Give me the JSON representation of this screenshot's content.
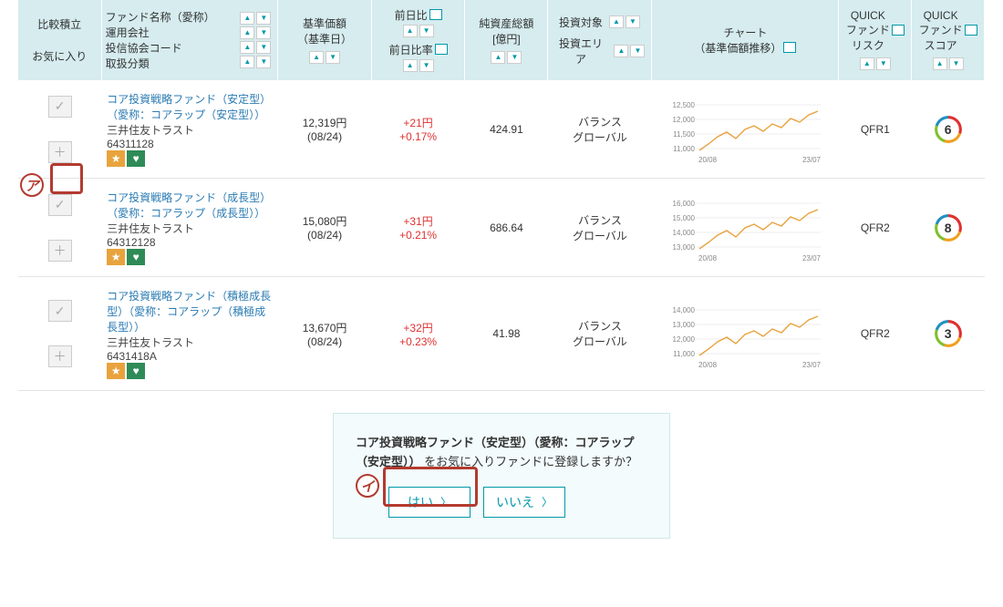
{
  "headers": {
    "compare": "比較積立",
    "favorite": "お気に入り",
    "fund_name": "ファンド名称（愛称）",
    "manager": "運用会社",
    "assoc_code": "投信協会コード",
    "category": "取扱分類",
    "price": "基準価額",
    "price_date": "（基準日）",
    "diff": "前日比",
    "diff_rate": "前日比率",
    "asset": "純資産総額",
    "asset_unit": "[億円]",
    "target": "投資対象",
    "area": "投資エリア",
    "chart": "チャート",
    "chart_sub": "（基準価額推移）",
    "risk": "QUICK\nファンド\nリスク",
    "score": "QUICK\nファンド\nスコア"
  },
  "rows": [
    {
      "name": "コア投資戦略ファンド（安定型）（愛称：コアラップ（安定型））",
      "company": "三井住友トラスト",
      "code": "64311128",
      "price": "12,319円",
      "date": "(08/24)",
      "diff": "+21円",
      "diff_rate": "+0.17%",
      "asset": "424.91",
      "target": "バランス",
      "area": "グローバル",
      "risk": "QFR1",
      "score": "6",
      "yticks": [
        "12,500",
        "12,000",
        "11,500",
        "11,000"
      ],
      "xfrom": "20/08",
      "xto": "23/07"
    },
    {
      "name": "コア投資戦略ファンド（成長型）（愛称：コアラップ（成長型））",
      "company": "三井住友トラスト",
      "code": "64312128",
      "price": "15,080円",
      "date": "(08/24)",
      "diff": "+31円",
      "diff_rate": "+0.21%",
      "asset": "686.64",
      "target": "バランス",
      "area": "グローバル",
      "risk": "QFR2",
      "score": "8",
      "yticks": [
        "16,000",
        "15,000",
        "14,000",
        "13,000"
      ],
      "xfrom": "20/08",
      "xto": "23/07"
    },
    {
      "name": "コア投資戦略ファンド（積極成長型）（愛称：コアラップ（積極成長型））",
      "company": "三井住友トラスト",
      "code": "6431418A",
      "price": "13,670円",
      "date": "(08/24)",
      "diff": "+32円",
      "diff_rate": "+0.23%",
      "asset": "41.98",
      "target": "バランス",
      "area": "グローバル",
      "risk": "QFR2",
      "score": "3",
      "yticks": [
        "14,000",
        "13,000",
        "12,000",
        "11,000"
      ],
      "xfrom": "20/08",
      "xto": "23/07"
    }
  ],
  "confirm": {
    "fund_name": "コア投資戦略ファンド（安定型）（愛称：コアラップ（安定型））",
    "message_tail": "をお気に入りファンドに登録しますか？",
    "yes": "はい",
    "no": "いいえ"
  },
  "annotations": {
    "a": "ア",
    "i": "イ"
  },
  "chart_data": [
    {
      "type": "line",
      "title": "コア投資戦略ファンド（安定型） 基準価額推移",
      "x_from": "20/08",
      "x_to": "23/07",
      "yticks": [
        11000,
        11500,
        12000,
        12500
      ],
      "ylim": [
        10800,
        12700
      ],
      "series": [
        {
          "name": "基準価額",
          "values_approx": [
            11000,
            11200,
            11700,
            12100,
            11800,
            12000,
            12200,
            12350
          ]
        }
      ]
    },
    {
      "type": "line",
      "title": "コア投資戦略ファンド（成長型） 基準価額推移",
      "x_from": "20/08",
      "x_to": "23/07",
      "yticks": [
        13000,
        14000,
        15000,
        16000
      ],
      "ylim": [
        12800,
        16200
      ],
      "series": [
        {
          "name": "基準価額",
          "values_approx": [
            13000,
            13400,
            14200,
            14800,
            14300,
            14600,
            14900,
            15300
          ]
        }
      ]
    },
    {
      "type": "line",
      "title": "コア投資戦略ファンド（積極成長型） 基準価額推移",
      "x_from": "20/08",
      "x_to": "23/07",
      "yticks": [
        11000,
        12000,
        13000,
        14000
      ],
      "ylim": [
        10500,
        14500
      ],
      "series": [
        {
          "name": "基準価額",
          "values_approx": [
            11000,
            11600,
            12400,
            13000,
            12500,
            12800,
            13200,
            13700
          ]
        }
      ]
    }
  ]
}
